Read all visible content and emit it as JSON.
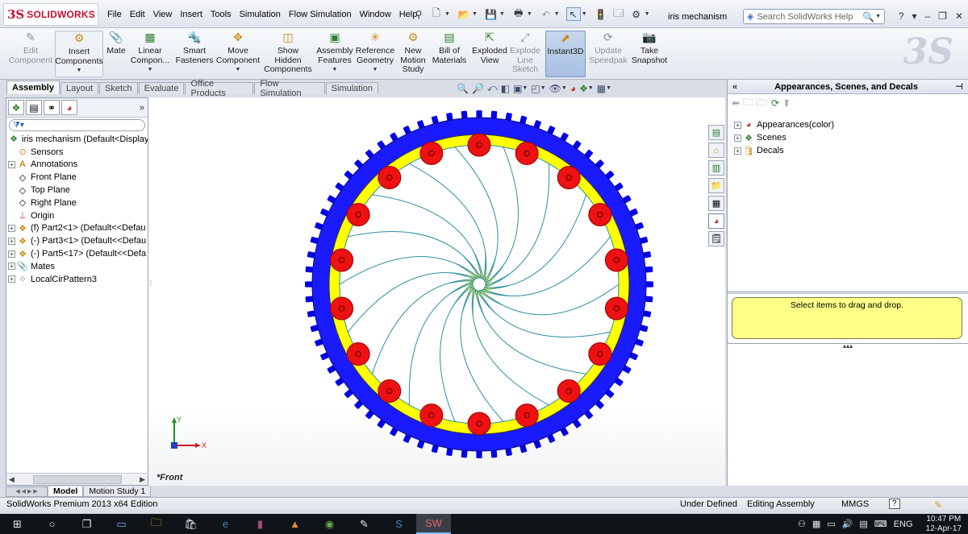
{
  "app": {
    "logo_ds": "3S",
    "logo_name": "SOLIDWORKS",
    "document_title": "iris mechanism",
    "menus": [
      "File",
      "Edit",
      "View",
      "Insert",
      "Tools",
      "Simulation",
      "Flow Simulation",
      "Window",
      "Help"
    ],
    "search_placeholder": "Search SolidWorks Help",
    "window_controls": [
      "?",
      "▾",
      "–",
      "❐",
      "✕"
    ]
  },
  "command_manager": {
    "edit_component": "Edit\nComponent",
    "insert_components": "Insert\nComponents",
    "mate": "Mate",
    "linear_component": "Linear\nCompon...",
    "smart_fasteners": "Smart\nFasteners",
    "move_component": "Move\nComponent",
    "show_hidden": "Show\nHidden\nComponents",
    "assembly_features": "Assembly\nFeatures",
    "reference_geometry": "Reference\nGeometry",
    "new_motion_study": "New\nMotion\nStudy",
    "bill_of_materials": "Bill of\nMaterials",
    "exploded_view": "Exploded\nView",
    "explode_line_sketch": "Explode\nLine\nSketch",
    "instant3d": "Instant3D",
    "update_speedpak": "Update\nSpeedpak",
    "take_snapshot": "Take\nSnapshot"
  },
  "tabs": [
    "Assembly",
    "Layout",
    "Sketch",
    "Evaluate",
    "Office Products",
    "Flow Simulation",
    "Simulation"
  ],
  "feature_tree": {
    "root": "iris mechanism  (Default<Display",
    "items": [
      {
        "label": "Sensors",
        "expandable": false
      },
      {
        "label": "Annotations",
        "expandable": true
      },
      {
        "label": "Front Plane",
        "expandable": false
      },
      {
        "label": "Top Plane",
        "expandable": false
      },
      {
        "label": "Right Plane",
        "expandable": false
      },
      {
        "label": "Origin",
        "expandable": false
      },
      {
        "label": "(f) Part2<1> (Default<<Defau",
        "expandable": true
      },
      {
        "label": "(-) Part3<1> (Default<<Defau",
        "expandable": true
      },
      {
        "label": "(-) Part5<17> (Default<<Defa",
        "expandable": true
      },
      {
        "label": "Mates",
        "expandable": true
      },
      {
        "label": "LocalCirPattern3",
        "expandable": true
      }
    ]
  },
  "graphics": {
    "view_label": "*Front",
    "triad_x": "X",
    "triad_y": "Y",
    "model": {
      "teeth": 72,
      "blades": 18,
      "pins": 18,
      "colors": {
        "gear_ring": "#1a1aff",
        "teeth": "#0000e6",
        "yellow_ring": "#ffff00",
        "blade_fill": "#ffffff",
        "blade_stroke": "#2f8fa6",
        "pin": "#ee1111",
        "pin_outline": "#990000"
      }
    }
  },
  "right_panel": {
    "title": "Appearances, Scenes, and Decals",
    "items": [
      "Appearances(color)",
      "Scenes",
      "Decals"
    ],
    "drop_hint": "Select items to drag and drop."
  },
  "bottom_tabs": [
    "Model",
    "Motion Study 1"
  ],
  "status": {
    "edition": "SolidWorks Premium 2013 x64 Edition",
    "state": "Under Defined",
    "mode": "Editing Assembly",
    "units": "MMGS",
    "help": "?"
  },
  "taskbar": {
    "lang": "ENG",
    "time": "10:47 PM",
    "date": "12-Apr-17"
  }
}
